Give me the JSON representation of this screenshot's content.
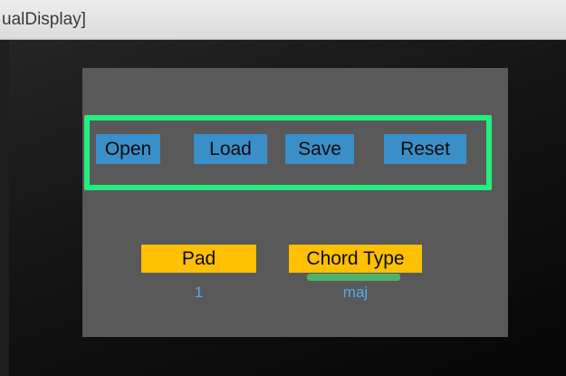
{
  "window": {
    "title": "ualDisplay]"
  },
  "toolbar": {
    "open_label": "Open",
    "load_label": "Load",
    "save_label": "Save",
    "reset_label": "Reset"
  },
  "fields": {
    "pad": {
      "label": "Pad",
      "value": "1"
    },
    "chord_type": {
      "label": "Chord Type",
      "value": "maj"
    }
  },
  "colors": {
    "panel": "#595959",
    "highlight": "#21f07e",
    "button": "#3a8fc9",
    "label_box": "#ffc000",
    "value_text": "#58a8f0",
    "indicator": "#4fb26a"
  }
}
